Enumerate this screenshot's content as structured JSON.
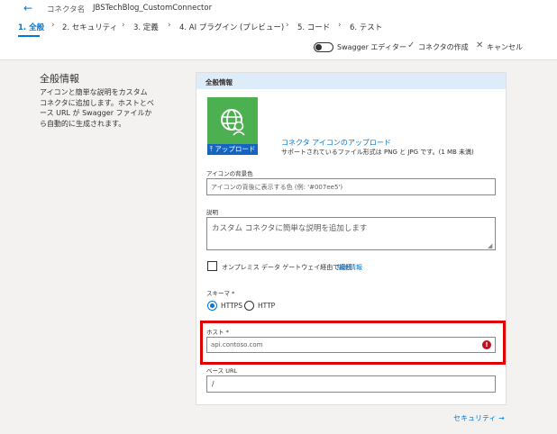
{
  "header": {
    "back_icon": "arrow-left-icon",
    "connector_label": "コネクタ名",
    "connector_name": "JBSTechBlog_CustomConnector"
  },
  "steps": [
    {
      "label": "1. 全般",
      "active": true
    },
    {
      "label": "2. セキュリティ",
      "active": false
    },
    {
      "label": "3. 定義",
      "active": false
    },
    {
      "label": "4. AI プラグイン (プレビュー)",
      "active": false
    },
    {
      "label": "5. コード",
      "active": false
    },
    {
      "label": "6. テスト",
      "active": false
    }
  ],
  "toolbar": {
    "swagger_label": "Swagger エディター",
    "create_label": "コネクタの作成",
    "cancel_label": "キャンセル"
  },
  "left": {
    "title": "全般情報",
    "description": "アイコンと簡単な説明をカスタム コネクタに追加します。ホストとベース URL が Swagger ファイルから自動的に生成されます。"
  },
  "card": {
    "title": "全般情報",
    "upload_button": "⤒ アップロード",
    "upload_link": "コネクタ アイコンのアップロード",
    "upload_note": "サポートされているファイル形式は PNG と JPG です。(1 MB 未満)",
    "icon_bg": {
      "label": "アイコンの背景色",
      "placeholder": "アイコンの背後に表示する色 (例: '#007ee5')"
    },
    "description": {
      "label": "説明",
      "placeholder": "カスタム コネクタに簡単な説明を追加します"
    },
    "gateway": {
      "label": "オンプレミス データ ゲートウェイ経由で接続",
      "link": "詳細情報"
    },
    "scheme": {
      "label": "スキーマ *",
      "options": [
        "HTTPS",
        "HTTP"
      ],
      "selected": "HTTPS"
    },
    "host": {
      "label": "ホスト *",
      "value": "api.contoso.com"
    },
    "base_url": {
      "label": "ベース URL",
      "value": "/"
    }
  },
  "footer": {
    "next_label": "セキュリティ →"
  },
  "colors": {
    "accent": "#0078d4",
    "icon_bg": "#4caf50",
    "upload_bar": "#1565c0",
    "highlight": "#e00000",
    "error": "#c50f1f",
    "card_header": "#deecf9"
  }
}
